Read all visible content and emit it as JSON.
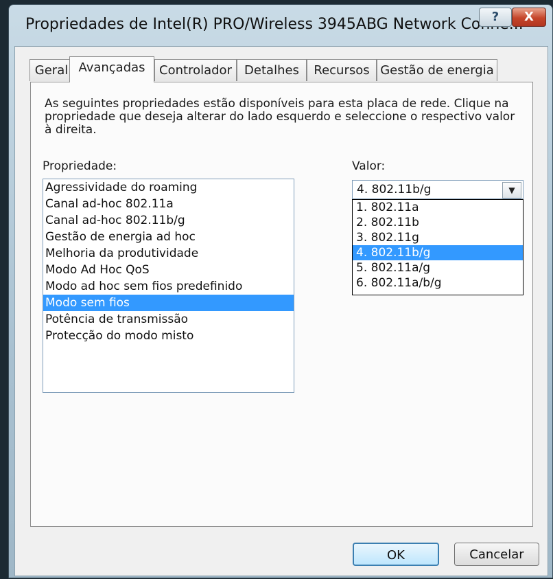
{
  "window": {
    "title": "Propriedades de Intel(R) PRO/Wireless 3945ABG Network Conne...",
    "help_label": "?",
    "close_label": "X"
  },
  "tabs": [
    {
      "label": "Geral"
    },
    {
      "label": "Avançadas"
    },
    {
      "label": "Controlador"
    },
    {
      "label": "Detalhes"
    },
    {
      "label": "Recursos"
    },
    {
      "label": "Gestão de energia"
    }
  ],
  "active_tab": "Avançadas",
  "description": "As seguintes propriedades estão disponíveis para esta placa de rede. Clique na propriedade que deseja alterar do lado esquerdo e seleccione o respectivo valor à direita.",
  "property": {
    "label": "Propriedade:",
    "items": [
      "Agressividade do roaming",
      "Canal ad-hoc 802.11a",
      "Canal ad-hoc 802.11b/g",
      "Gestão de energia ad hoc",
      "Melhoria da produtividade",
      "Modo Ad Hoc QoS",
      "Modo ad hoc sem fios predefinido",
      "Modo sem fios",
      "Potência de transmissão",
      "Protecção do modo misto"
    ],
    "selected_index": 7
  },
  "value": {
    "label": "Valor:",
    "current": "4. 802.11b/g",
    "options": [
      "1. 802.11a",
      "2. 802.11b",
      "3. 802.11g",
      "4. 802.11b/g",
      "5. 802.11a/g",
      "6. 802.11a/b/g"
    ],
    "selected_index": 3
  },
  "buttons": {
    "ok": "OK",
    "cancel": "Cancelar"
  },
  "colors": {
    "selection": "#3399ff",
    "close_button": "#c5452a"
  }
}
